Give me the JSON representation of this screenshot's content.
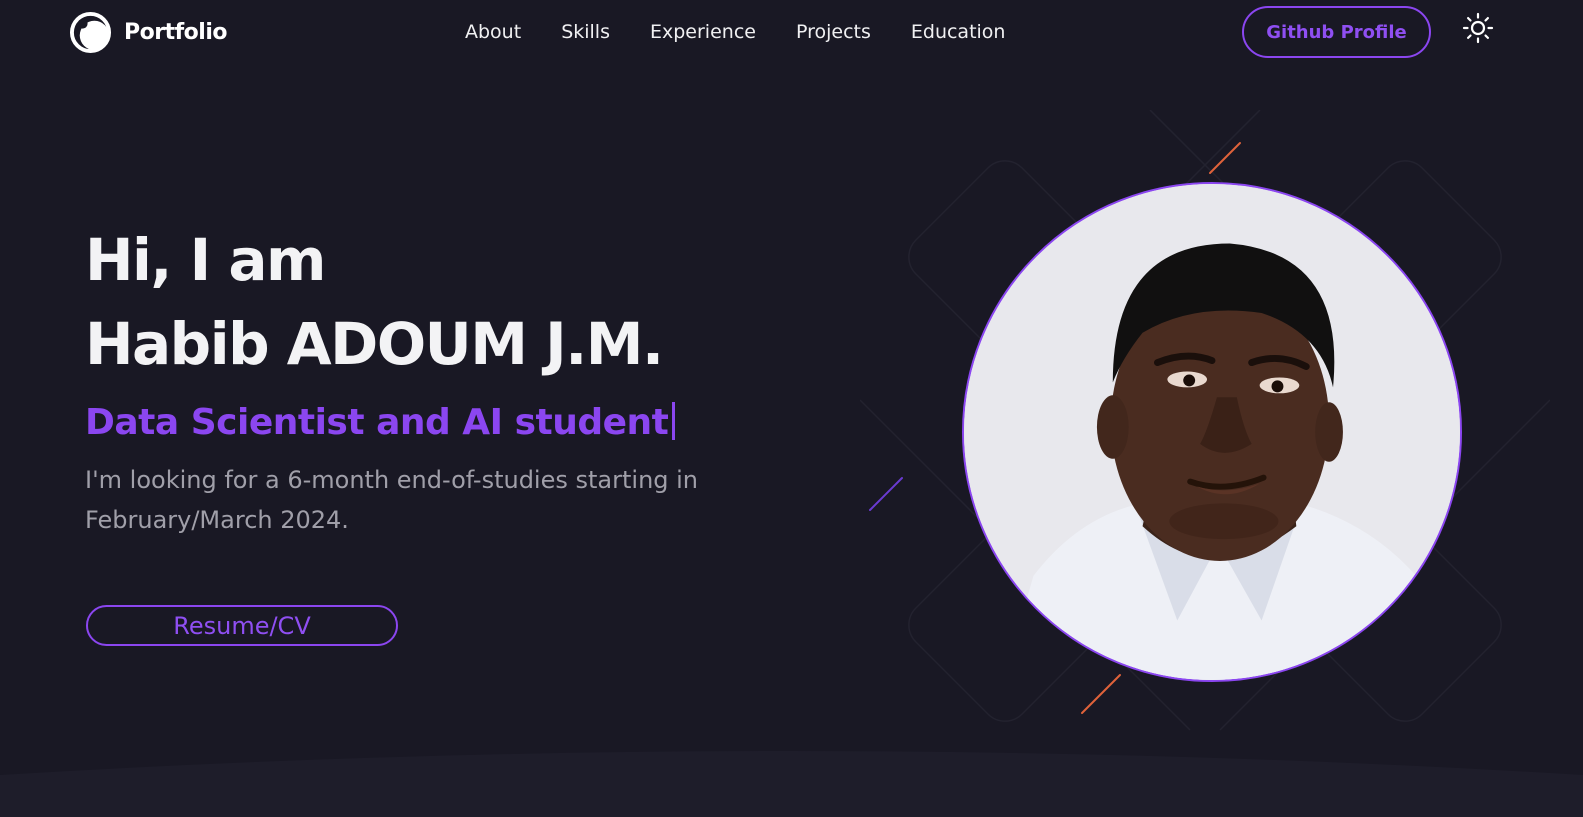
{
  "header": {
    "brand": "Portfolio",
    "nav": [
      "About",
      "Skills",
      "Experience",
      "Projects",
      "Education"
    ],
    "github_label": "Github Profile"
  },
  "hero": {
    "greeting": "Hi, I am",
    "name": "Habib ADOUM J.M.",
    "role": "Data Scientist and AI student",
    "description": "I'm looking for a 6-month end-of-studies starting in February/March 2024.",
    "resume_label": "Resume/CV"
  },
  "colors": {
    "background": "#191824",
    "accent": "#8b46f0",
    "text": "#f2f2f3",
    "muted_text": "#a09fa9",
    "decor_orange": "#e0623a"
  },
  "icons": {
    "brand": "logo-ring-icon",
    "theme": "sun-icon"
  }
}
